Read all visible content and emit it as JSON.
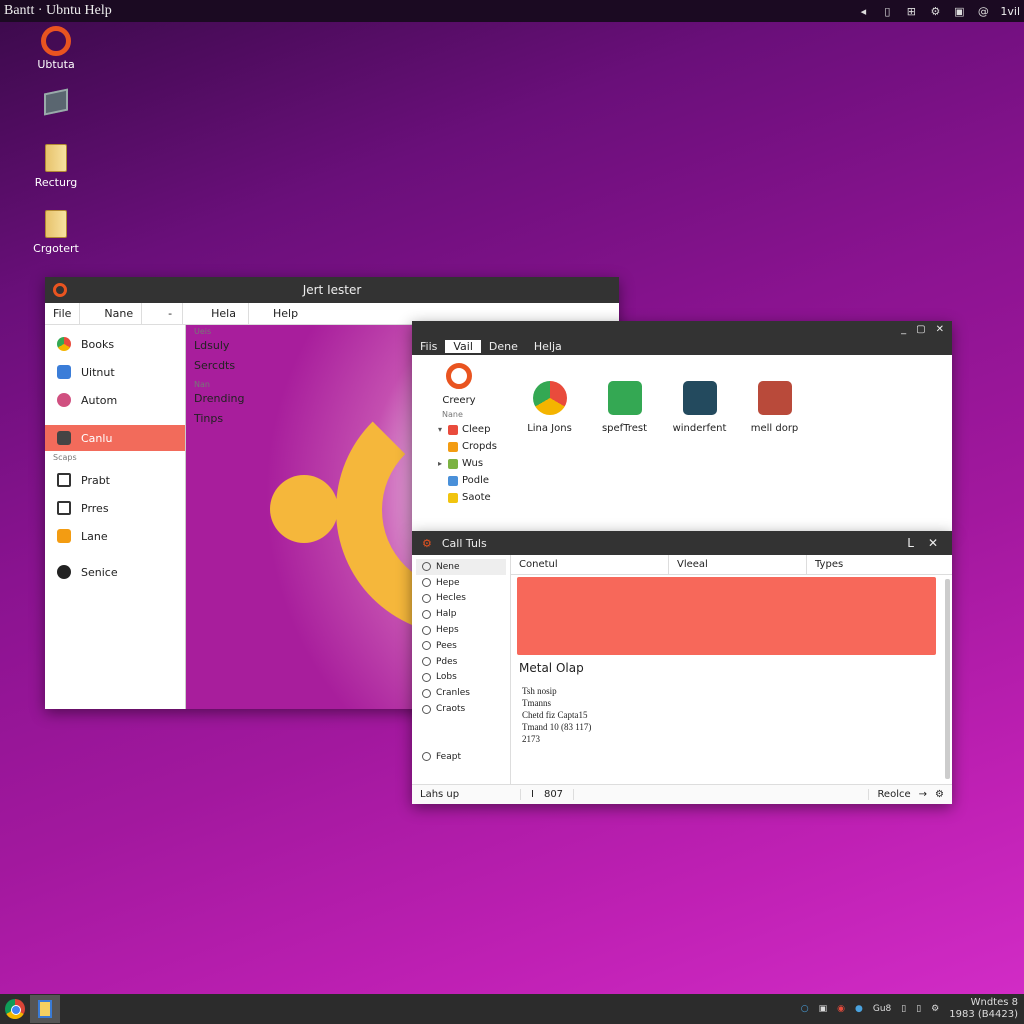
{
  "topbar": {
    "title": "Bantt · Ubntu Help",
    "icons": [
      "speaker-icon",
      "calendar-icon",
      "network-icon",
      "settings-icon",
      "battery-icon",
      "user-icon"
    ],
    "time": "1vil"
  },
  "desktop": {
    "icons": [
      {
        "label": "Ubtuta",
        "icon": "ubuntu-logo-icon"
      },
      {
        "label": "",
        "icon": "monitor-icon"
      },
      {
        "label": "Recturg",
        "icon": "folder-icon"
      },
      {
        "label": "Crgotert",
        "icon": "folder-icon"
      }
    ]
  },
  "window1": {
    "title": "Jert Iester",
    "menu": [
      "File",
      "Nane",
      "-",
      "Hela",
      "Help"
    ],
    "sidebar": [
      {
        "label": "Books",
        "color": "#e94b3c"
      },
      {
        "label": "Uitnut",
        "color": "#3b7dd8"
      },
      {
        "label": "Autom",
        "color": "#d05080"
      },
      {
        "label": "Canlu",
        "color": "#444",
        "active": true
      },
      {
        "section": "Scaps"
      },
      {
        "label": "Prabt",
        "color": "#333"
      },
      {
        "label": "Prres",
        "color": "#333"
      },
      {
        "label": "Lane",
        "color": "#f39c12"
      },
      {
        "label": "Senice",
        "color": "#222"
      }
    ],
    "main": {
      "tiny1": "Ueis",
      "line1": "Ldsuly",
      "line2": "Sercdts",
      "tiny2": "Nan",
      "line3": "Drending",
      "line4": "Tinps"
    }
  },
  "window2": {
    "controls": [
      "_",
      "▢",
      "✕"
    ],
    "menu": [
      "Fiis",
      "Vail",
      "Dene",
      "Helja"
    ],
    "active_menu": 1,
    "tree": {
      "root": "Creery",
      "tiny": "Nane",
      "nodes": [
        {
          "label": "Cleep",
          "arrow": "▾",
          "color": "#e94b3c"
        },
        {
          "label": "Cropds",
          "arrow": "",
          "color": "#f39c12"
        },
        {
          "label": "Wus",
          "arrow": "▸",
          "color": "#7cb342"
        },
        {
          "label": "Podle",
          "arrow": "",
          "color": "#4a90d9"
        },
        {
          "label": "Saote",
          "arrow": "",
          "color": "#f1c40f"
        }
      ]
    },
    "apps": [
      {
        "label": "Lina Jons",
        "color": "#e94b3c"
      },
      {
        "label": "spefTrest",
        "color": "#34a853"
      },
      {
        "label": "winderfent",
        "color": "#234a5e"
      },
      {
        "label": "mell dorp",
        "color": "#b94a3a"
      }
    ]
  },
  "window3": {
    "title": "Call Tuls",
    "controls": [
      "L",
      "✕"
    ],
    "sidebar": [
      {
        "label": "Nene",
        "active": true
      },
      {
        "label": "Hepe"
      },
      {
        "label": "Hecles"
      },
      {
        "label": "Halp"
      },
      {
        "label": "Heps"
      },
      {
        "label": "Pees"
      },
      {
        "label": "Pdes"
      },
      {
        "label": "Lobs"
      },
      {
        "label": "Cranles"
      },
      {
        "label": "Craots"
      }
    ],
    "sidebar_footer": "Feapt",
    "columns": [
      "Conetul",
      "Vleeal",
      "Types"
    ],
    "banner_color": "#f7685a",
    "heading": "Metal Olap",
    "text": [
      "Tsh nosip",
      "Tmanns",
      "Chetd fiz Capta15",
      "Tmand 10 (83 117)",
      "2173"
    ],
    "status": {
      "left": "Lahs up",
      "num": "807",
      "right": "Reolce"
    }
  },
  "taskbar": {
    "tray": [
      "info-icon",
      "save-icon",
      "browser-icon",
      "cloud-icon"
    ],
    "tray_text": "Gu8",
    "clock_line1": "Wndtes 8",
    "clock_line2": "1983 (B4423)"
  }
}
